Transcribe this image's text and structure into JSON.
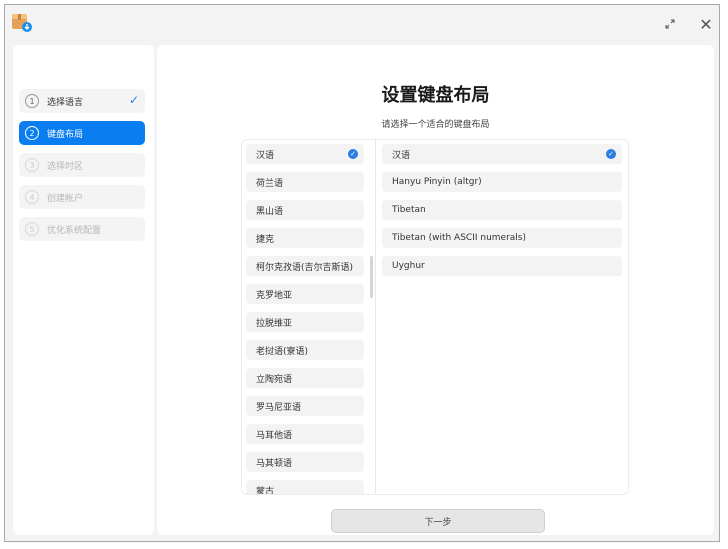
{
  "steps": [
    {
      "num": "1",
      "label": "选择语言",
      "state": "done"
    },
    {
      "num": "2",
      "label": "键盘布局",
      "state": "active"
    },
    {
      "num": "3",
      "label": "选择时区",
      "state": "pending"
    },
    {
      "num": "4",
      "label": "创建帐户",
      "state": "pending"
    },
    {
      "num": "5",
      "label": "优化系统配置",
      "state": "pending"
    }
  ],
  "page": {
    "title": "设置键盘布局",
    "subtitle": "请选择一个适合的键盘布局"
  },
  "languages": [
    {
      "label": "汉语",
      "selected": true
    },
    {
      "label": "荷兰语"
    },
    {
      "label": "黑山语"
    },
    {
      "label": "捷克"
    },
    {
      "label": "柯尔克孜语(吉尔吉斯语)"
    },
    {
      "label": "克罗地亚"
    },
    {
      "label": "拉脱维亚"
    },
    {
      "label": "老挝语(寮语)"
    },
    {
      "label": "立陶宛语"
    },
    {
      "label": "罗马尼亚语"
    },
    {
      "label": "马耳他语"
    },
    {
      "label": "马其顿语"
    },
    {
      "label": "蒙古"
    }
  ],
  "layouts": [
    {
      "label": "汉语",
      "selected": true
    },
    {
      "label": "Hanyu Pinyin (altgr)"
    },
    {
      "label": "Tibetan"
    },
    {
      "label": "Tibetan (with ASCII numerals)"
    },
    {
      "label": "Uyghur"
    }
  ],
  "buttons": {
    "next": "下一步"
  },
  "icons": {
    "check": "✓",
    "resize": "⤡",
    "close": "✕"
  },
  "colors": {
    "accent": "#0a7ef0"
  }
}
